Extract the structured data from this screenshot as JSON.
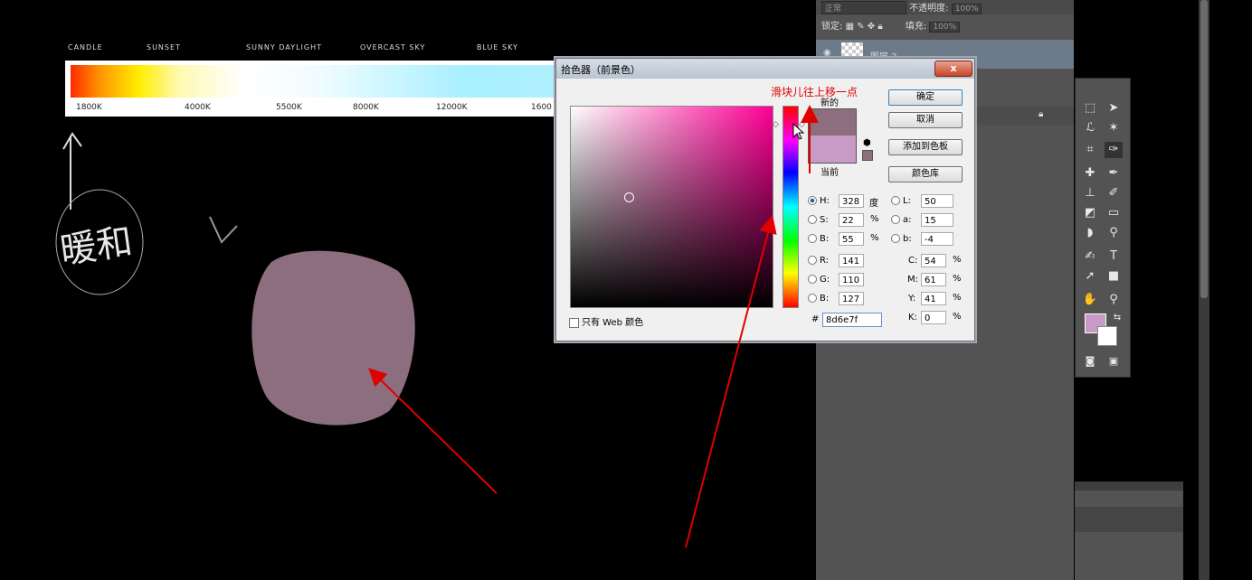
{
  "temperature_chart": {
    "top_labels": [
      "CANDLE",
      "SUNSET",
      "SUNNY DAYLIGHT",
      "OVERCAST SKY",
      "BLUE SKY"
    ],
    "bottom_labels": [
      "1800K",
      "4000K",
      "5500K",
      "8000K",
      "12000K",
      "1600"
    ]
  },
  "canvas": {
    "scribble_text": "暖和",
    "blob_color": "#8d6e7f"
  },
  "annotation": {
    "text": "滑块儿往上移一点",
    "color": "#e00000"
  },
  "layers_panel": {
    "blend_mode": "正常",
    "opacity_label": "不透明度:",
    "opacity_value": "100%",
    "lock_label": "锁定:",
    "fill_label": "填充:",
    "fill_value": "100%",
    "layer_name": "图层 2"
  },
  "dialog": {
    "title": "拾色器（前景色）",
    "close_label": "x",
    "new_label": "新的",
    "current_label": "当前",
    "new_color": "#8d6e7f",
    "current_color": "#c79bc6",
    "buttons": {
      "ok": "确定",
      "cancel": "取消",
      "add_to_swatches": "添加到色板",
      "color_libraries": "颜色库"
    },
    "fields": {
      "H": {
        "label": "H:",
        "value": "328",
        "unit": "度"
      },
      "S": {
        "label": "S:",
        "value": "22",
        "unit": "%"
      },
      "B": {
        "label": "B:",
        "value": "55",
        "unit": "%"
      },
      "R": {
        "label": "R:",
        "value": "141"
      },
      "G": {
        "label": "G:",
        "value": "110"
      },
      "Bb": {
        "label": "B:",
        "value": "127"
      },
      "L": {
        "label": "L:",
        "value": "50"
      },
      "a": {
        "label": "a:",
        "value": "15"
      },
      "b": {
        "label": "b:",
        "value": "-4"
      },
      "C": {
        "label": "C:",
        "value": "54",
        "unit": "%"
      },
      "M": {
        "label": "M:",
        "value": "61",
        "unit": "%"
      },
      "Y": {
        "label": "Y:",
        "value": "41",
        "unit": "%"
      },
      "K": {
        "label": "K:",
        "value": "0",
        "unit": "%"
      }
    },
    "hex_label": "#",
    "hex_value": "8d6e7f",
    "web_only_label": "只有 Web 颜色"
  }
}
